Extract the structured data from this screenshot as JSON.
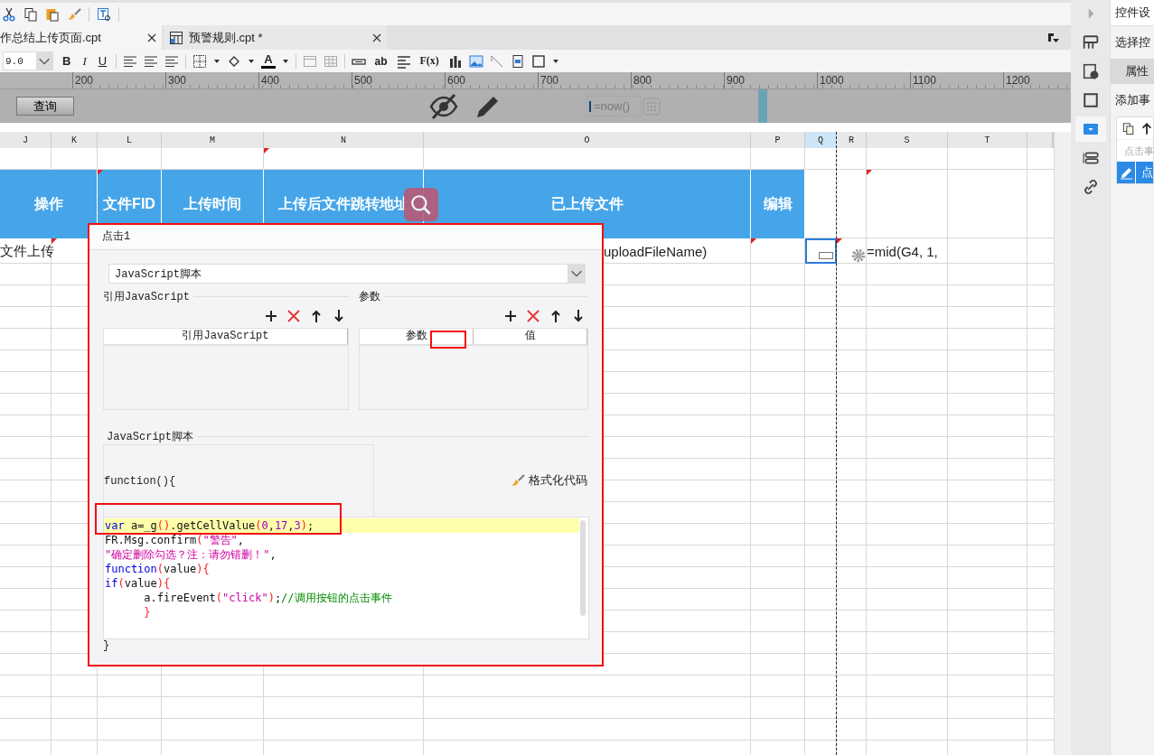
{
  "tabs": [
    {
      "label": "作总结上传页面.cpt",
      "selected": true
    },
    {
      "label": "预警规则.cpt *",
      "selected": false
    }
  ],
  "format_bar": {
    "font_size": "9.0",
    "style_buttons": [
      "B",
      "I",
      "U"
    ],
    "text_buttons": [
      "ab",
      "F(x)"
    ],
    "font_color_button": "A"
  },
  "ruler": [
    "200",
    "300",
    "400",
    "500",
    "600",
    "700",
    "800",
    "900",
    "1000",
    "1100",
    "1200"
  ],
  "parameter_pane": {
    "query_button": "查询",
    "date_field": "=now()"
  },
  "sheet": {
    "columns": [
      {
        "label": "J",
        "selected": false
      },
      {
        "label": "K",
        "selected": false
      },
      {
        "label": "L",
        "selected": false
      },
      {
        "label": "M",
        "selected": false
      },
      {
        "label": "N",
        "selected": false
      },
      {
        "label": "O",
        "selected": false
      },
      {
        "label": "P",
        "selected": false
      },
      {
        "label": "Q",
        "selected": true
      },
      {
        "label": "R",
        "selected": false
      },
      {
        "label": "S",
        "selected": false
      },
      {
        "label": "T",
        "selected": false
      }
    ],
    "rows": [
      {
        "kind": "blank",
        "cells": [
          {},
          {},
          {},
          {},
          {
            "flagged": true
          },
          {},
          {},
          {},
          {},
          {},
          {}
        ]
      },
      {
        "kind": "header",
        "cells": [
          {
            "text": "操作"
          },
          {
            "merged": true
          },
          {
            "text": "文件FID",
            "flagged": true
          },
          {
            "text": "上传时间"
          },
          {
            "text": "上传后文件跳转地址"
          },
          {
            "text": "已上传文件"
          },
          {
            "text": "编辑"
          },
          {},
          {},
          {
            "flagged": true
          },
          {}
        ]
      },
      {
        "kind": "data",
        "cells": [
          {
            "text": "文件上传"
          },
          {
            "flagged": true
          },
          {},
          {},
          {},
          {
            "text": "uploadFileName)",
            "kind": "partial"
          },
          {
            "flagged": true
          },
          {
            "selected": true
          },
          {
            "flagged": true
          },
          {
            "text": "=mid(G4, 1,"
          },
          {}
        ]
      }
    ]
  },
  "dialog": {
    "title": "点击1",
    "type_select": "JavaScript脚本",
    "left_section": {
      "title": "引用JavaScript",
      "columns": [
        "引用JavaScript"
      ]
    },
    "right_section": {
      "title": "参数",
      "columns": [
        "参数",
        "值"
      ]
    },
    "script_section": "JavaScript脚本",
    "function_header": "function(){",
    "format_button": "格式化代码",
    "code": [
      {
        "highlighted": true,
        "tokens": [
          {
            "kind": "kw",
            "text": "var"
          },
          {
            "kind": "plain",
            "text": " a=_g"
          },
          {
            "kind": "paren",
            "text": "()"
          },
          {
            "kind": "plain",
            "text": ".getCellValue"
          },
          {
            "kind": "paren",
            "text": "("
          },
          {
            "kind": "num",
            "text": "0"
          },
          {
            "kind": "plain",
            "text": ","
          },
          {
            "kind": "num",
            "text": "17"
          },
          {
            "kind": "plain",
            "text": ","
          },
          {
            "kind": "num",
            "text": "3"
          },
          {
            "kind": "paren",
            "text": ")"
          },
          {
            "kind": "plain",
            "text": ";"
          }
        ]
      },
      {
        "highlighted": false,
        "tokens": [
          {
            "kind": "plain",
            "text": "FR.Msg.confirm"
          },
          {
            "kind": "paren",
            "text": "("
          },
          {
            "kind": "str",
            "text": "\"警告\""
          },
          {
            "kind": "plain",
            "text": ","
          }
        ]
      },
      {
        "highlighted": false,
        "tokens": [
          {
            "kind": "str",
            "text": "\"确定删除勾选？注：请勿错删！\""
          },
          {
            "kind": "plain",
            "text": ","
          }
        ]
      },
      {
        "highlighted": false,
        "tokens": [
          {
            "kind": "kw",
            "text": "function"
          },
          {
            "kind": "paren",
            "text": "("
          },
          {
            "kind": "plain",
            "text": "value"
          },
          {
            "kind": "paren",
            "text": ")"
          },
          {
            "kind": "paren",
            "text": "{"
          }
        ]
      },
      {
        "highlighted": false,
        "tokens": [
          {
            "kind": "kw",
            "text": "if"
          },
          {
            "kind": "paren",
            "text": "("
          },
          {
            "kind": "plain",
            "text": "value"
          },
          {
            "kind": "paren",
            "text": ")"
          },
          {
            "kind": "paren",
            "text": "{"
          }
        ]
      },
      {
        "highlighted": false,
        "tokens": [
          {
            "kind": "plain",
            "text": "      a.fireEvent"
          },
          {
            "kind": "paren",
            "text": "("
          },
          {
            "kind": "str",
            "text": "\"click\""
          },
          {
            "kind": "paren",
            "text": ")"
          },
          {
            "kind": "plain",
            "text": ";"
          },
          {
            "kind": "comment",
            "text": "//调用按钮的点击事件"
          }
        ]
      },
      {
        "highlighted": false,
        "tokens": [
          {
            "kind": "paren",
            "text": "      }"
          }
        ]
      }
    ],
    "function_footer": "}"
  },
  "side_panel": {
    "title": "控件设",
    "select_label": "选择控",
    "tab": "属性",
    "event_label": "添加事",
    "event_placeholder": "点击事",
    "event_item": "点"
  }
}
